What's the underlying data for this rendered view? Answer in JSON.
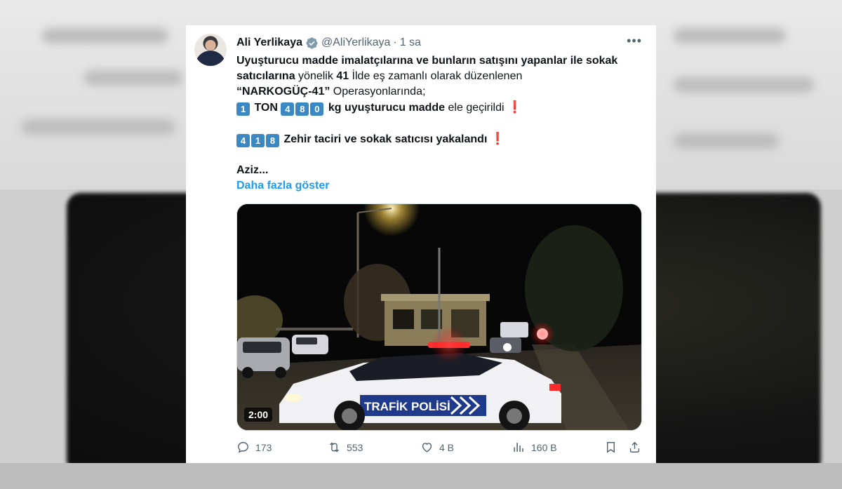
{
  "tweet": {
    "author_name": "Ali Yerlikaya",
    "handle": "@AliYerlikaya",
    "separator": "·",
    "time": "1 sa",
    "more_label": "•••",
    "lines": {
      "l1": "Uyuşturucu madde imalatçılarına ve bunların satışını yapanlar ile sokak",
      "l2_bold": "satıcılarına",
      "l2_a": " yönelik ",
      "l2_num": "41",
      "l2_b": " İlde eş zamanlı olarak düzenlenen",
      "l3_bold": "“NARKOGÜÇ-41”",
      "l3_rest": " Operasyonlarında;",
      "l4_key1": "1",
      "l4_ton": " TON ",
      "l4_k4": "4",
      "l4_k8": "8",
      "l4_k0": "0",
      "l4_bold": " kg uyuşturucu madde",
      "l4_rest": " ele geçirildi ",
      "l5_k4": "4",
      "l5_k1": "1",
      "l5_k8": "8",
      "l5_bold": " Zehir taciri ve sokak satıcısı yakalandı ",
      "l6": "Aziz...",
      "exclamation": "❗"
    },
    "show_more": "Daha fazla göster",
    "video": {
      "duration": "2:00",
      "car_label": "TRAFİK POLİSİ"
    },
    "stats": {
      "replies": "173",
      "reposts": "553",
      "likes": "4 B",
      "views": "160 B"
    },
    "colors": {
      "link": "#1d9bf0",
      "verified": "#829aab",
      "keycap": "#3b88c3",
      "muted": "#536471"
    },
    "icons": [
      "verified-badge-icon",
      "more-icon",
      "reply-icon",
      "repost-icon",
      "like-icon",
      "views-icon",
      "bookmark-icon",
      "share-icon"
    ]
  }
}
